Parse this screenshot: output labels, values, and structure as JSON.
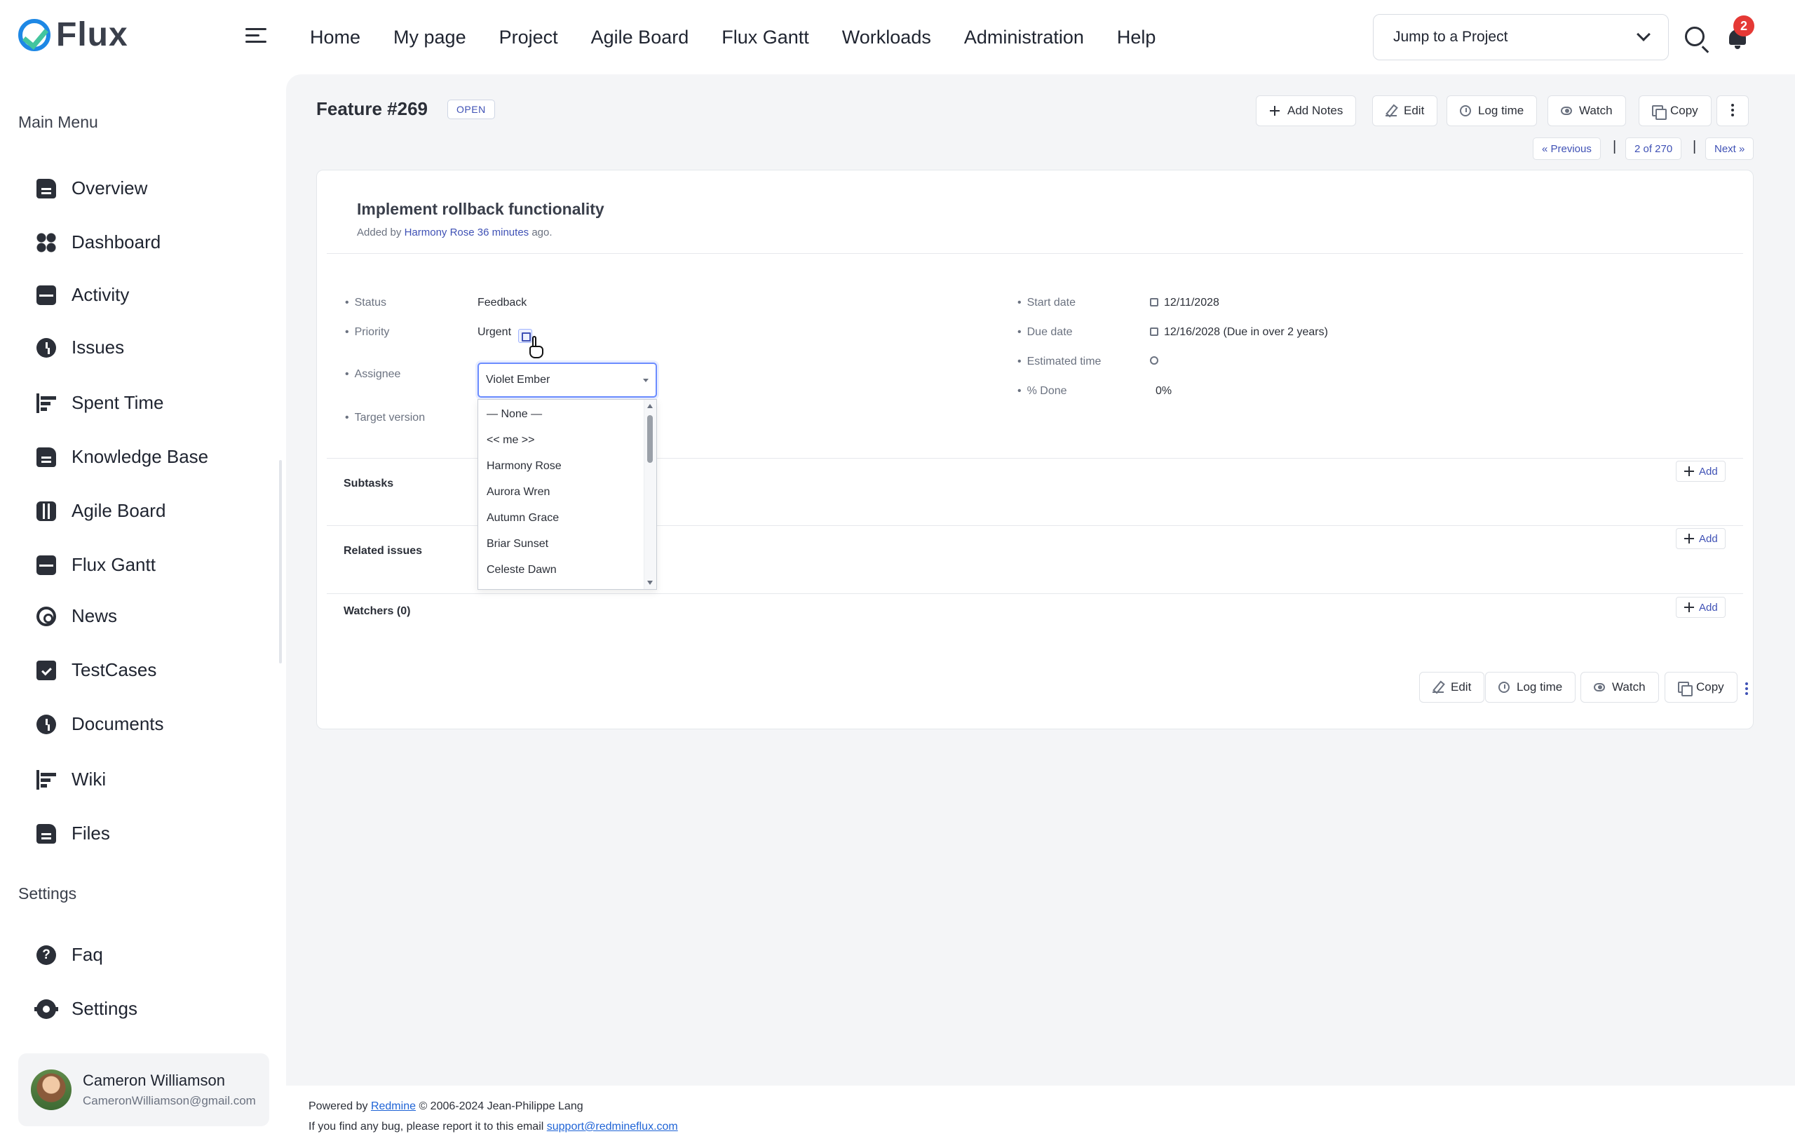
{
  "brand": {
    "name": "Flux"
  },
  "topnav": [
    "Home",
    "My page",
    "Project",
    "Agile Board",
    "Flux Gantt",
    "Workloads",
    "Administration",
    "Help"
  ],
  "jump": {
    "placeholder": "Jump to a Project"
  },
  "notifications": {
    "count": "2"
  },
  "sidebar": {
    "main_menu_title": "Main Menu",
    "items": [
      {
        "label": "Overview",
        "icon": "document-icon"
      },
      {
        "label": "Dashboard",
        "icon": "dashboard-icon"
      },
      {
        "label": "Activity",
        "icon": "activity-icon"
      },
      {
        "label": "Issues",
        "icon": "clock-icon"
      },
      {
        "label": "Spent Time",
        "icon": "bars-icon"
      },
      {
        "label": "Knowledge Base",
        "icon": "document-icon"
      },
      {
        "label": "Agile Board",
        "icon": "board-icon"
      },
      {
        "label": "Flux Gantt",
        "icon": "activity-icon"
      },
      {
        "label": "News",
        "icon": "refresh-icon"
      },
      {
        "label": "TestCases",
        "icon": "clipboard-check-icon"
      },
      {
        "label": "Documents",
        "icon": "clock-icon"
      },
      {
        "label": "Wiki",
        "icon": "bars-icon"
      },
      {
        "label": "Files",
        "icon": "document-icon"
      }
    ],
    "settings_title": "Settings",
    "settings_items": [
      {
        "label": "Faq",
        "icon": "help-icon"
      },
      {
        "label": "Settings",
        "icon": "gear-icon"
      }
    ],
    "user": {
      "name": "Cameron Williamson",
      "email": "CameronWilliamson@gmail.com"
    }
  },
  "issue": {
    "title": "Feature #269",
    "status_badge": "OPEN",
    "actions": {
      "add_notes": "Add Notes",
      "edit": "Edit",
      "log_time": "Log time",
      "watch": "Watch",
      "copy": "Copy"
    },
    "pager": {
      "previous": "« Previous",
      "position": "2 of 270",
      "next": "Next »",
      "separator": "|"
    },
    "subject": "Implement rollback functionality",
    "added_prefix": "Added by",
    "author": "Harmony Rose",
    "age": "36 minutes",
    "added_suffix": "ago.",
    "attributes": {
      "status_label": "Status",
      "status": "Feedback",
      "priority_label": "Priority",
      "priority": "Urgent",
      "assignee_label": "Assignee",
      "assignee": "Violet Ember",
      "target_version_label": "Target version",
      "start_date_label": "Start date",
      "start_date": "12/11/2028",
      "due_date_label": "Due date",
      "due_date": "12/16/2028 (Due in over 2 years)",
      "estimated_time_label": "Estimated time",
      "done_label": "% Done",
      "done": "0%"
    },
    "assignee_options": [
      "— None —",
      "<< me >>",
      "Harmony Rose",
      "Aurora Wren",
      "Autumn Grace",
      "Briar Sunset",
      "Celeste Dawn"
    ],
    "sections": {
      "subtasks": "Subtasks",
      "related": "Related issues",
      "watchers": "Watchers (0)",
      "add": "Add"
    }
  },
  "footer": {
    "powered_prefix": "Powered by",
    "redmine": "Redmine",
    "powered_suffix": "© 2006-2024 Jean-Philippe Lang",
    "bug_text": "If you find any bug, please report it to this email",
    "email": "support@redmineflux.com"
  },
  "colors": {
    "accent": "#3f51b5",
    "badge": "#e53935",
    "focus": "#6b8cff"
  }
}
